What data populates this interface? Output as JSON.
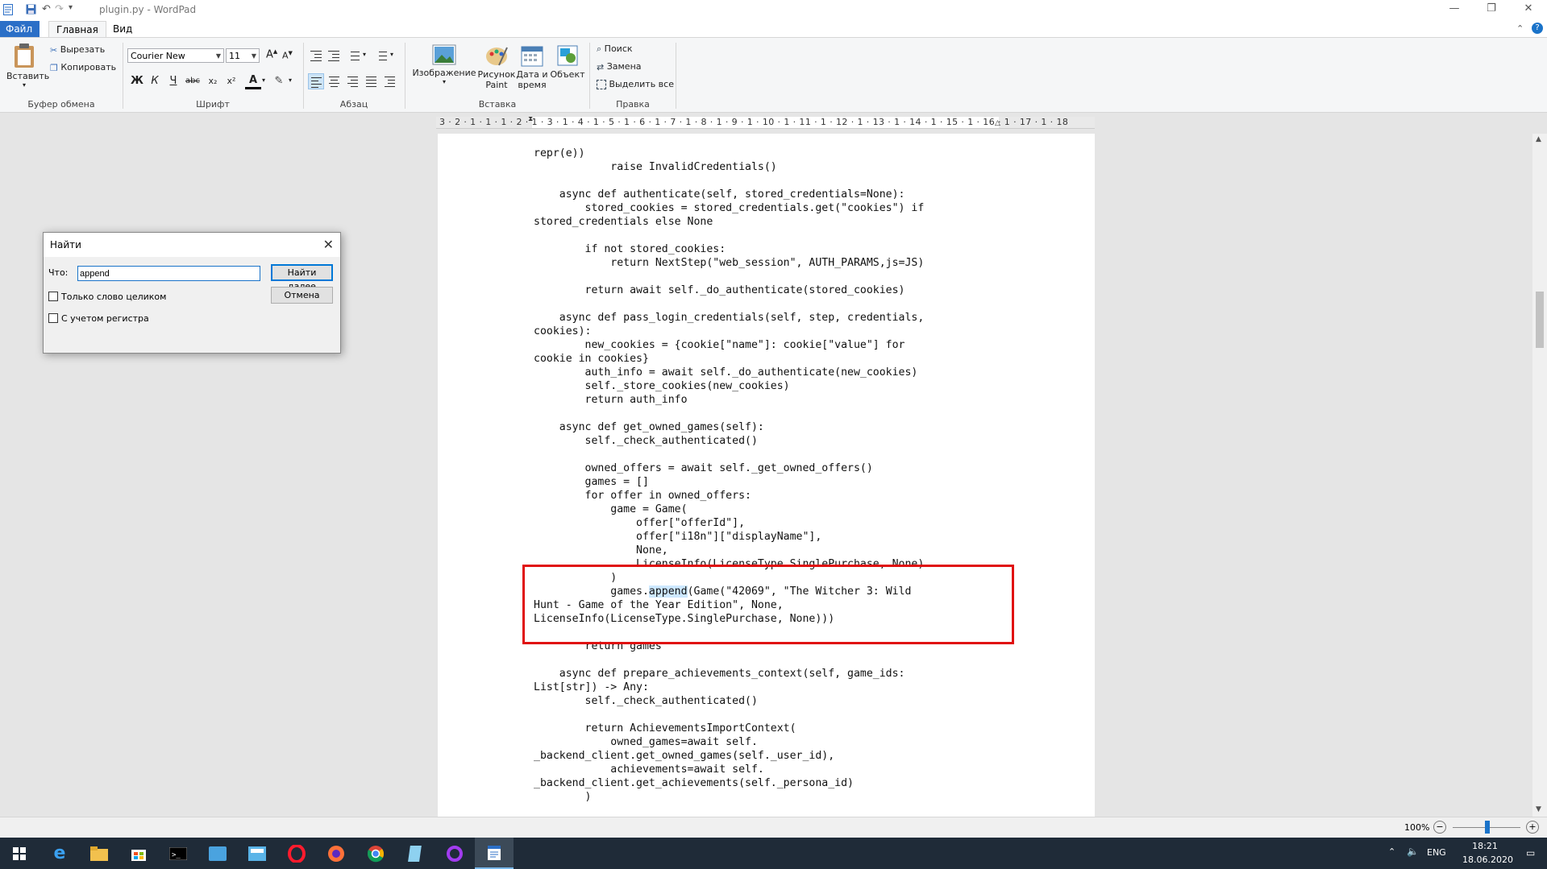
{
  "window": {
    "title": "plugin.py - WordPad",
    "qat_dropdown": "▾",
    "controls": {
      "minimize": "—",
      "restore": "❐",
      "close": "✕"
    }
  },
  "ribbon": {
    "tabs": [
      {
        "label": "Файл"
      },
      {
        "label": "Главная"
      },
      {
        "label": "Вид"
      }
    ],
    "clipboard": {
      "paste": "Вставить",
      "cut": "Вырезать",
      "copy": "Копировать",
      "group": "Буфер обмена"
    },
    "font": {
      "family": "Courier New",
      "size": "11",
      "group": "Шрифт",
      "bold": "Ж",
      "italic": "К",
      "underline": "Ч",
      "strike": "abc",
      "sub": "x₂",
      "sup": "x²",
      "color_a": "A"
    },
    "paragraph": {
      "group": "Абзац"
    },
    "insert": {
      "picture": "Изображение",
      "paint_1": "Рисунок",
      "paint_2": "Paint",
      "datetime_1": "Дата и",
      "datetime_2": "время",
      "object": "Объект",
      "group": "Вставка"
    },
    "editing": {
      "find": "Поиск",
      "replace": "Замена",
      "select_all": "Выделить все",
      "group": "Правка"
    }
  },
  "ruler": {
    "text": "3 · 2 · 1 · 1 · 1 · 2 · 1 · 3 · 1 · 4 · 1 · 5 · 1 · 6 · 1 · 7 · 1 · 8 · 1 · 9 · 1 · 10 · 1 · 11 · 1 · 12 · 1 · 13 · 1 · 14 · 1 · 15 · 1 · 16 · 1 · 17 · 1 · 18"
  },
  "document": {
    "code_before": "repr(e))\n            raise InvalidCredentials()\n\n    async def authenticate(self, stored_credentials=None):\n        stored_cookies = stored_credentials.get(\"cookies\") if\nstored_credentials else None\n\n        if not stored_cookies:\n            return NextStep(\"web_session\", AUTH_PARAMS,js=JS)\n\n        return await self._do_authenticate(stored_cookies)\n\n    async def pass_login_credentials(self, step, credentials,\ncookies):\n        new_cookies = {cookie[\"name\"]: cookie[\"value\"] for\ncookie in cookies}\n        auth_info = await self._do_authenticate(new_cookies)\n        self._store_cookies(new_cookies)\n        return auth_info\n\n    async def get_owned_games(self):\n        self._check_authenticated()\n\n        owned_offers = await self._get_owned_offers()\n        games = []\n        for offer in owned_offers:\n            game = Game(\n                offer[\"offerId\"],\n                offer[\"i18n\"][\"displayName\"],\n                None,\n                LicenseInfo(LicenseType.SinglePurchase, None)\n            )\n            games.",
    "code_match": "append",
    "code_after": "(Game(\"42069\", \"The Witcher 3: Wild\nHunt - Game of the Year Edition\", None,\nLicenseInfo(LicenseType.SinglePurchase, None)))\n\n        return games\n\n    async def prepare_achievements_context(self, game_ids:\nList[str]) -> Any:\n        self._check_authenticated()\n\n        return AchievementsImportContext(\n            owned_games=await self.\n_backend_client.get_owned_games(self._user_id),\n            achievements=await self.\n_backend_client.get_achievements(self._persona_id)\n        )"
  },
  "find_dialog": {
    "title": "Найти",
    "what_label": "Что:",
    "query": "append",
    "find_next": "Найти далее",
    "cancel": "Отмена",
    "whole_word": "Только слово целиком",
    "match_case": "С учетом регистра"
  },
  "statusbar": {
    "zoom": "100%",
    "zoom_out": "−",
    "zoom_in": "+"
  },
  "taskbar": {
    "icons": [
      "windows-start",
      "edge",
      "file-explorer",
      "store",
      "terminal",
      "app-blue",
      "app-calc",
      "opera",
      "firefox",
      "chrome",
      "notepad",
      "circle-app",
      "wordpad"
    ],
    "lang": "ENG",
    "time": "18:21",
    "date": "18.06.2020"
  },
  "colors": {
    "file_tab": "#2b6fc7",
    "highlight": "#cde8ff",
    "annotation_box": "#e01010",
    "taskbar": "#1f2b38"
  }
}
